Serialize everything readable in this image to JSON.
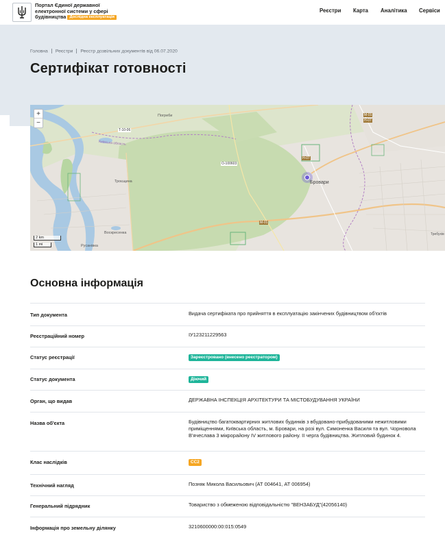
{
  "header": {
    "portal_title": "Портал Єдиної державної електронної системи у сфері будівництва",
    "portal_title_line1": "Портал Єдиної державної",
    "portal_title_line2": "електронної системи у сфері",
    "portal_title_line3": "будівництва",
    "badge": "Дослідна експлуатація",
    "nav": [
      "Реєстри",
      "Карта",
      "Аналітика",
      "Сервіси"
    ]
  },
  "breadcrumb": [
    "Головна",
    "Реєстри",
    "Реєстр дозвільних документів від 06.07.2020"
  ],
  "page_title": "Сертифікат готовності",
  "map": {
    "zoom_in": "+",
    "zoom_out": "−",
    "scale_km": "2 km",
    "scale_mi": "1 mi",
    "labels": {
      "brovary": "Бровари",
      "rusanivka": "Русанівка",
      "voskresenka": "Воскресенка",
      "troieshchyna": "Троєщина",
      "pohreby": "Погреби",
      "kyivska_oblast": "Київська область",
      "road_m01": "M-01",
      "road_h07": "H-07",
      "road_t1006": "T-10-06",
      "road_o100603": "O-100603",
      "trebukhiv": "Требухів"
    },
    "marker_color": "#6e5bd6"
  },
  "main": {
    "section_title": "Основна інформація",
    "rows": [
      {
        "label": "Тип документа",
        "value": "Видача сертифіката про прийняття в експлуатацію закінчених будівництвом об'єктів"
      },
      {
        "label": "Реєстраційний номер",
        "value": "ІУ123211229563"
      },
      {
        "label": "Статус реєстрації",
        "value": "Зареєстровано (внесено реєстратором)"
      },
      {
        "label": "Статус документа",
        "value": "Діючий"
      },
      {
        "label": "Орган, що видав",
        "value": "ДЕРЖАВНА ІНСПЕКЦІЯ АРХІТЕКТУРИ ТА МІСТОБУДУВАННЯ УКРАЇНИ"
      },
      {
        "label": "Назва об'єкта",
        "value": "Будівництво багатоквартирних житлових будинків з вбудовано-прибудованими нежитловими приміщеннями, Київська область, м. Бровари, на розі вул. Симоненка Василя та вул. Чорновола В'ячеслава 3 мікрорайону IV житлового району. ІІ черга будівництва. Житловий будинок 4."
      },
      {
        "label": "Клас наслідків",
        "value": "СС2"
      },
      {
        "label": "Технічний нагляд",
        "value": "Позняк Микола Васильович (АТ 004641, АТ 006954)"
      },
      {
        "label": "Генеральний підрядник",
        "value": "Товариство з обмеженою відповідальністю \"ВЕНЗАБУД\"(42056140)"
      },
      {
        "label": "Інформація про земельну ділянку",
        "value": "3210600000:00:015:0549"
      }
    ]
  },
  "colors": {
    "tag_green": "#1fb59a",
    "tag_orange": "#f5a623",
    "hero_bg": "#e3e9ef"
  }
}
